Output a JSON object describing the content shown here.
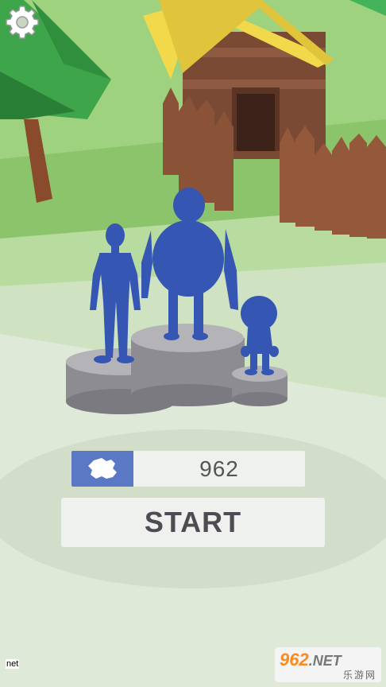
{
  "score": {
    "value": "962",
    "flag_icon": "antarctica-flag-icon",
    "flag_color": "#5a78c4"
  },
  "start_button": {
    "label": "START"
  },
  "settings": {
    "icon": "gear-icon"
  },
  "corner_tag": "net",
  "watermark": {
    "main": "962",
    "suffix": ".NET",
    "sub": "乐游网"
  },
  "colors": {
    "character": "#3556b2",
    "pedestal": "#8d8c92",
    "grass": "#cfe2c2",
    "ground": "#dfe9d8"
  }
}
